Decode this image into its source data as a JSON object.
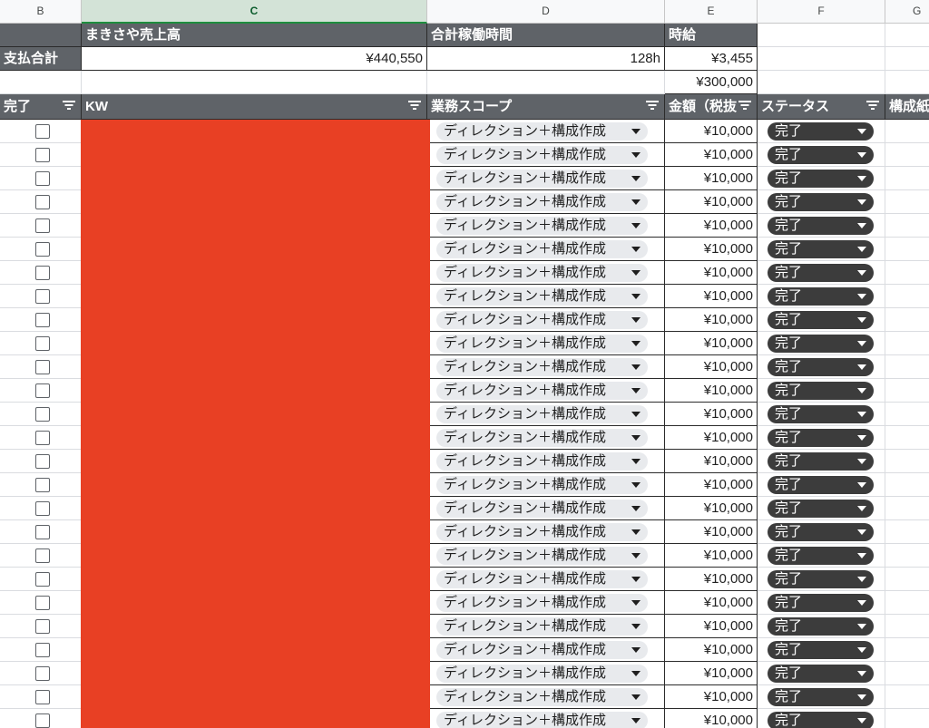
{
  "column_headers": [
    "B",
    "C",
    "D",
    "E",
    "F",
    "G"
  ],
  "summary_header": {
    "c": "まきさや売上高",
    "d": "合計稼働時間",
    "e": "時給"
  },
  "summary_row": {
    "label": "支払合計",
    "sales": "¥440,550",
    "hours": "128h",
    "hourly": "¥3,455"
  },
  "extra_value": "¥300,000",
  "table_header": {
    "done": "完了",
    "kw": "KW",
    "scope": "業務スコープ",
    "amount": "金額（税抜",
    "status": "ステータス",
    "next": "構成紙"
  },
  "row_template": {
    "scope": "ディレクション＋構成作成",
    "amount": "¥10,000",
    "status": "完了"
  },
  "colors": {
    "header_dark": "#5f6368",
    "redaction": "#e84024",
    "status_chip": "#3c3c3c",
    "scope_chip": "#e8eaed",
    "selected_column": "#d3e3d7"
  },
  "icons": [
    "filter-icon",
    "dropdown-caret-icon",
    "checkbox-icon"
  ]
}
